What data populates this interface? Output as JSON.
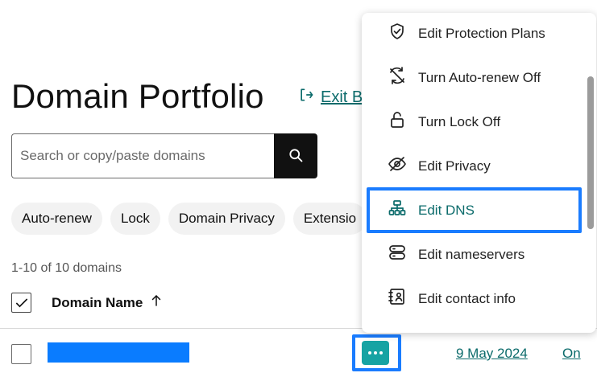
{
  "header": {
    "title": "Domain Portfolio",
    "exit_label": "Exit B"
  },
  "search": {
    "placeholder": "Search or copy/paste domains"
  },
  "filters": [
    {
      "label": "Auto-renew"
    },
    {
      "label": "Lock"
    },
    {
      "label": "Domain Privacy"
    },
    {
      "label": "Extensio"
    }
  ],
  "results": {
    "count_label": "1-10 of 10 domains"
  },
  "table": {
    "header_domain": "Domain Name",
    "sort_icon": "arrow-up-icon",
    "row": {
      "expires": "9 May 2024",
      "auto_renew": "On"
    }
  },
  "menu": {
    "items": [
      {
        "label": "Edit Protection Plans",
        "icon": "shield-check-icon"
      },
      {
        "label": "Turn Auto-renew Off",
        "icon": "sync-off-icon"
      },
      {
        "label": "Turn Lock Off",
        "icon": "lock-open-icon"
      },
      {
        "label": "Edit Privacy",
        "icon": "eye-off-icon"
      },
      {
        "label": "Edit DNS",
        "icon": "network-icon"
      },
      {
        "label": "Edit nameservers",
        "icon": "server-icon"
      },
      {
        "label": "Edit contact info",
        "icon": "contact-card-icon"
      }
    ],
    "selected": "Edit DNS"
  },
  "colors": {
    "accent_teal": "#0b6b6b",
    "more_button": "#16a3a3",
    "focus_blue": "#1a7cff",
    "redaction": "#0a7cff"
  }
}
